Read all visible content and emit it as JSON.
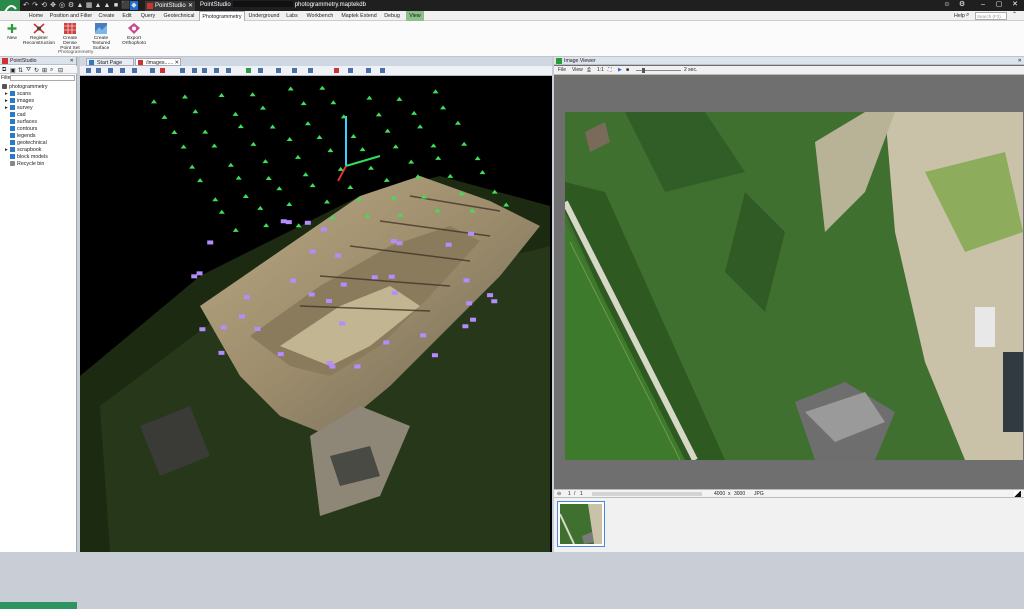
{
  "titlebar": {
    "tab_label": "PointStudio",
    "window_title_prefix": "PointStudio",
    "window_title_suffix": "photogrammetry.maptekdb",
    "min": "–",
    "max": "▢",
    "close": "✕"
  },
  "menu": {
    "items": [
      "Home",
      "Position and Filter",
      "Create",
      "Edit",
      "Query",
      "Geotechnical",
      "Photogrammetry",
      "Underground",
      "Labs",
      "Workbench",
      "Maptek Extend",
      "Debug",
      "View"
    ],
    "active": "Photogrammetry",
    "help": "Help",
    "search_placeholder": "Search (F3)"
  },
  "ribbon": {
    "buttons": [
      "New",
      "Register Reconstruction",
      "Create Dense Point Set",
      "Create Textured Surface",
      "Export Orthophoto"
    ],
    "group_label": "Photogrammetry"
  },
  "left_panel": {
    "title": "PointStudio",
    "filter_label": "Filter",
    "tree": [
      {
        "label": "photogrammetry",
        "expanded": true
      },
      {
        "label": "scans",
        "expanded": false
      },
      {
        "label": "images",
        "expanded": false
      },
      {
        "label": "survey",
        "expanded": false
      },
      {
        "label": "cad",
        "expanded": false
      },
      {
        "label": "surfaces",
        "expanded": false
      },
      {
        "label": "contours",
        "expanded": false
      },
      {
        "label": "legends",
        "expanded": false
      },
      {
        "label": "geotechnical",
        "expanded": false
      },
      {
        "label": "scrapbook",
        "expanded": false
      },
      {
        "label": "block models",
        "expanded": false
      },
      {
        "label": "Recycle bin",
        "expanded": false
      }
    ]
  },
  "view3d": {
    "tabs": [
      "Start Page",
      "/images......"
    ]
  },
  "image_viewer": {
    "title": "Image Viewer",
    "menu": [
      "File",
      "View"
    ],
    "scale": "1:1",
    "interval": "2 sec.",
    "page_current": "1",
    "page_sep": "/",
    "page_total": "1",
    "width": "4000",
    "by": "x",
    "height": "3000",
    "format": "JPG"
  },
  "colors": {
    "titlebar": "#1f1f1f",
    "accent_green": "#2f9560",
    "view_menu_green": "#8bc08b",
    "camera_marker_green": "#3ee05a",
    "photo_marker_purple": "#b58cff"
  }
}
